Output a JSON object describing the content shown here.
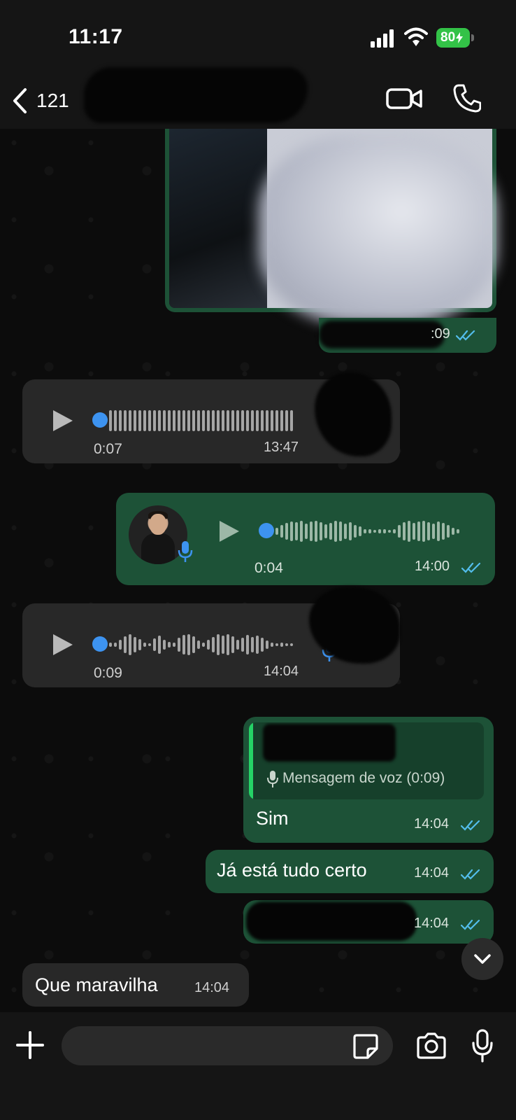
{
  "status": {
    "time": "11:17",
    "battery": "80"
  },
  "header": {
    "back_count": "121",
    "contact_name": ""
  },
  "messages": {
    "image": {
      "time": ":09"
    },
    "voice1": {
      "duration": "0:07",
      "time": "13:47"
    },
    "voice2": {
      "duration": "0:04",
      "time": "14:00"
    },
    "voice3": {
      "duration": "0:09",
      "time": "14:04"
    },
    "reply": {
      "quoted": "Mensagem de voz (0:09)",
      "text": "Sim",
      "time": "14:04"
    },
    "text1": {
      "text": "Já está tudo certo",
      "time": "14:04"
    },
    "text2": {
      "time": "14:04"
    },
    "incoming": {
      "text": "Que maravilha",
      "time": "14:04"
    }
  },
  "composer": {
    "placeholder": ""
  },
  "colors": {
    "outgoing": "#1d5237",
    "incoming": "#282828",
    "accent": "#25d366",
    "link": "#3d93f0"
  },
  "icons": [
    "back-chevron-icon",
    "video-call-icon",
    "phone-icon",
    "play-icon",
    "mic-icon",
    "read-ticks-icon",
    "chevron-down-icon",
    "plus-icon",
    "sticker-icon",
    "camera-icon"
  ]
}
